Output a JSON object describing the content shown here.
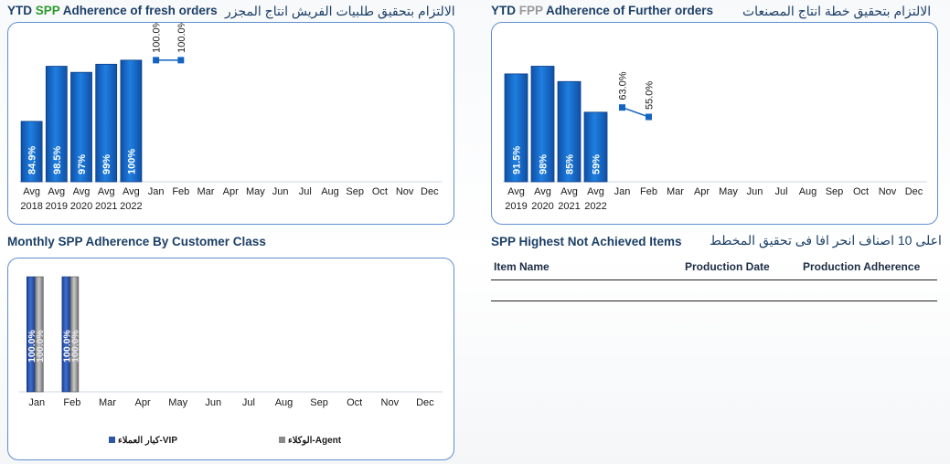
{
  "panel1": {
    "title_prefix": "YTD ",
    "title_tag": "SPP",
    "title_rest": " Adherence of fresh orders",
    "title_arabic": "الالتزام بتحقيق طلبيات الفريش انتاج المجزر",
    "chart_data": {
      "type": "bar",
      "categories": [
        "Avg 2018",
        "Avg 2019",
        "Avg 2020",
        "Avg 2021",
        "Avg 2022",
        "Jan",
        "Feb",
        "Mar",
        "Apr",
        "May",
        "Jun",
        "Jul",
        "Aug",
        "Sep",
        "Oct",
        "Nov",
        "Dec"
      ],
      "tick_top": [
        "Avg",
        "Avg",
        "Avg",
        "Avg",
        "Avg",
        "Jan",
        "Feb",
        "Mar",
        "Apr",
        "May",
        "Jun",
        "Jul",
        "Aug",
        "Sep",
        "Oct",
        "Nov",
        "Dec"
      ],
      "tick_bottom": [
        "2018",
        "2019",
        "2020",
        "2021",
        "2022",
        "",
        "",
        "",
        "",
        "",
        "",
        "",
        "",
        "",
        "",
        "",
        ""
      ],
      "bars": [
        84.9,
        98.5,
        97,
        99,
        100
      ],
      "bar_labels": [
        "84.9%",
        "98.5%",
        "97%",
        "99%",
        "100%"
      ],
      "line_values": [
        100,
        100
      ],
      "line_labels": [
        "100.0%",
        "100.0%"
      ],
      "ylim": [
        70,
        102
      ]
    }
  },
  "panel2": {
    "title_prefix": "YTD ",
    "title_tag": "FPP",
    "title_rest": " Adherence of Further orders",
    "title_arabic": "الالتزام بتحقيق خطة انتاج المصنعات",
    "chart_data": {
      "type": "bar",
      "categories": [
        "Avg 2019",
        "Avg 2020",
        "Avg 2021",
        "Avg 2022",
        "Jan",
        "Feb",
        "Mar",
        "Apr",
        "May",
        "Jun",
        "Jul",
        "Aug",
        "Sep",
        "Oct",
        "Nov",
        "Dec"
      ],
      "tick_top": [
        "Avg",
        "Avg",
        "Avg",
        "Avg",
        "Jan",
        "Feb",
        "Mar",
        "Apr",
        "May",
        "Jun",
        "Jul",
        "Aug",
        "Sep",
        "Oct",
        "Nov",
        "Dec"
      ],
      "tick_bottom": [
        "2019",
        "2020",
        "2021",
        "2022",
        "",
        "",
        "",
        "",
        "",
        "",
        "",
        "",
        "",
        "",
        "",
        ""
      ],
      "bars": [
        91.5,
        98,
        85,
        59
      ],
      "bar_labels": [
        "91.5%",
        "98%",
        "85%",
        "59%"
      ],
      "line_values": [
        63.0,
        55.0
      ],
      "line_labels": [
        "63.0%",
        "55.0%"
      ],
      "ylim": [
        0,
        110
      ]
    }
  },
  "panel3": {
    "title": "Monthly SPP Adherence By Customer Class",
    "chart_data": {
      "type": "bar",
      "categories": [
        "Jan",
        "Feb",
        "Mar",
        "Apr",
        "May",
        "Jun",
        "Jul",
        "Aug",
        "Sep",
        "Oct",
        "Nov",
        "Dec"
      ],
      "series": [
        {
          "name": "كبار العملاء-VIP",
          "values": [
            100,
            100
          ],
          "labels": [
            "100.0%",
            "100.0%"
          ]
        },
        {
          "name": "الوكلاء-Agent",
          "values": [
            100,
            100
          ],
          "labels": [
            "100.0%",
            "100.0%"
          ]
        }
      ],
      "ylim": [
        0,
        100
      ]
    }
  },
  "panel4": {
    "title": "SPP Highest Not Achieved Items",
    "title_arabic": "اعلى 10 اصناف انحر افا فى تحقيق المخطط",
    "columns": [
      "Item Name",
      "Production Date",
      "Production Adherence"
    ]
  },
  "colors": {
    "bar_blue": "#1f7fe0",
    "bar_dark": "#0f4fa6",
    "line_blue": "#1565c0",
    "grey_bar": "#8a8a8a",
    "vip_legend": "#2f55a4"
  }
}
